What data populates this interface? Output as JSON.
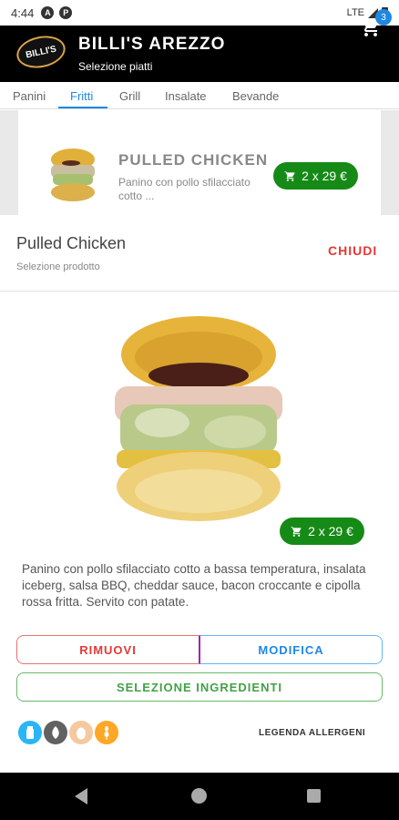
{
  "status": {
    "time": "4:44",
    "network": "LTE"
  },
  "app": {
    "title": "BILLI'S AREZZO",
    "subtitle": "Selezione piatti",
    "logo_text": "BILLI'S",
    "cart_count": "3"
  },
  "tabs": [
    {
      "label": "Panini",
      "active": false
    },
    {
      "label": "Fritti",
      "active": true
    },
    {
      "label": "Grill",
      "active": false
    },
    {
      "label": "Insalate",
      "active": false
    },
    {
      "label": "Bevande",
      "active": false
    }
  ],
  "list_item": {
    "name": "PULLED CHICKEN",
    "description": "Panino con pollo sfilacciato cotto ...",
    "price": "2 x 29 €"
  },
  "detail": {
    "title": "Pulled Chicken",
    "subtitle": "Selezione prodotto",
    "close_label": "CHIUDI",
    "price": "2 x 29 €",
    "description": "Panino con pollo sfilacciato cotto a bassa temperatura, insalata iceberg, salsa BBQ, cheddar sauce, bacon croccante e cipolla rossa fritta. Servito con patate.",
    "remove_label": "RIMUOVI",
    "modify_label": "MODIFICA",
    "ingredients_label": "SELEZIONE INGREDIENTI",
    "legend_label": "LEGENDA ALLERGENI",
    "allergens": [
      {
        "icon": "milk-icon",
        "color": "#29b6f6"
      },
      {
        "icon": "fish-icon",
        "color": "#616161"
      },
      {
        "icon": "egg-icon",
        "color": "#f4c9a0"
      },
      {
        "icon": "gluten-icon",
        "color": "#ffa726"
      }
    ]
  },
  "colors": {
    "price_green": "#168a16",
    "accent_blue": "#1e88e5",
    "close_red": "#e53935"
  }
}
